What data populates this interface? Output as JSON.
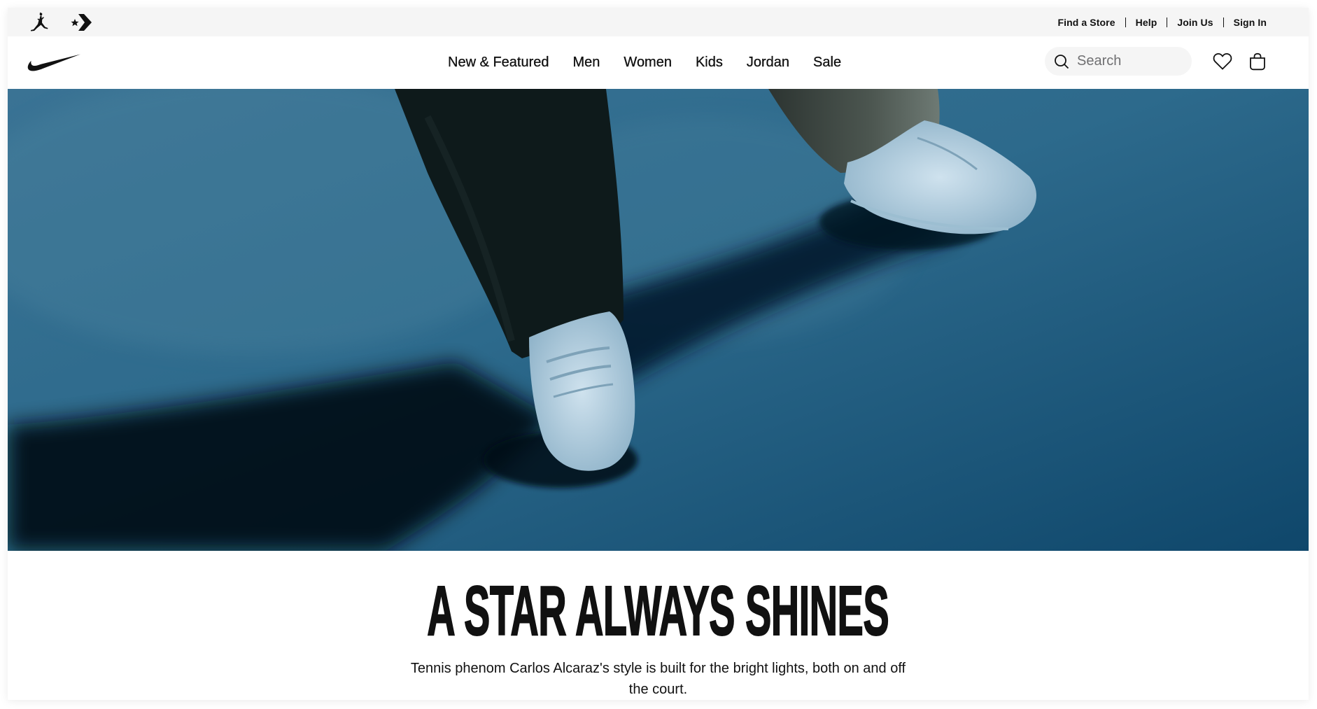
{
  "utility_bar": {
    "brands": [
      {
        "name": "Jordan",
        "icon": "jumpman-icon"
      },
      {
        "name": "Converse",
        "icon": "converse-star-chevron-icon"
      }
    ],
    "links": [
      "Find a Store",
      "Help",
      "Join Us",
      "Sign In"
    ]
  },
  "main_nav": {
    "logo": "nike-swoosh-icon",
    "links": [
      "New & Featured",
      "Men",
      "Women",
      "Kids",
      "Jordan",
      "Sale"
    ],
    "search": {
      "placeholder": "Search",
      "value": "",
      "icon": "search-icon"
    },
    "favorites_icon": "heart-icon",
    "bag_icon": "bag-icon"
  },
  "hero": {
    "image_description": "Close-up of feet in white sneakers on a blue tennis court with long diagonal shadows",
    "colors": {
      "court": "#2a6688",
      "shadow": "#04111b",
      "pants_left": "#0f1a1c",
      "pants_right": "#4b5550",
      "shoe": "#b9d3e2"
    }
  },
  "promo": {
    "headline": "A STAR ALWAYS SHINES",
    "subcopy": "Tennis phenom Carlos Alcaraz's style is built for the bright lights, both on and off the court."
  },
  "colors": {
    "text": "#111111",
    "utility_bg": "#f5f5f5",
    "search_bg": "#f5f5f5",
    "placeholder": "#707072"
  }
}
